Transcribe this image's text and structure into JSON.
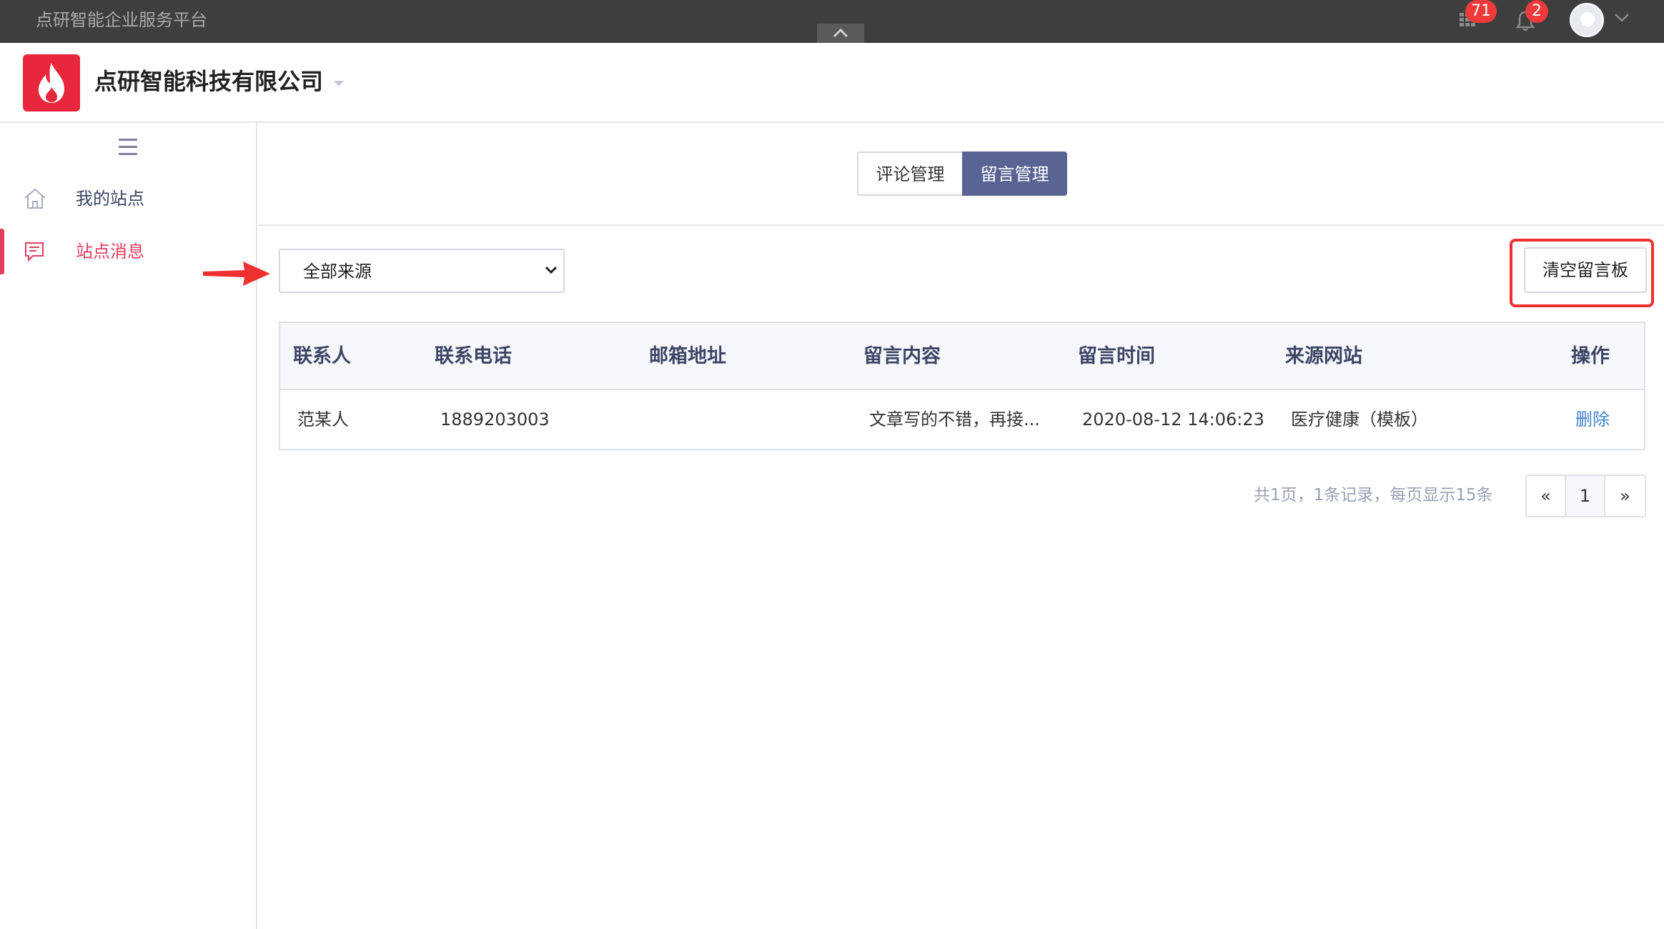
{
  "topbar": {
    "title": "点研智能企业服务平台",
    "apps_badge": "71",
    "notify_badge": "2",
    "icons": [
      "apps-grid-icon",
      "bell-icon",
      "avatar",
      "chevron-down-icon",
      "chevron-up-icon"
    ]
  },
  "header": {
    "company": "点研智能科技有限公司",
    "logo_icon": "flame-icon",
    "brand_color": "#e8263c"
  },
  "sidebar": {
    "items": [
      {
        "label": "我的站点",
        "icon": "home-icon",
        "active": false
      },
      {
        "label": "站点消息",
        "icon": "message-icon",
        "active": true
      }
    ],
    "active_color": "#e23d5e"
  },
  "tabs": [
    {
      "label": "评论管理",
      "selected": false
    },
    {
      "label": "留言管理",
      "selected": true
    }
  ],
  "filter": {
    "source_value": "全部来源"
  },
  "toolbar": {
    "clear_label": "清空留言板"
  },
  "table": {
    "columns": [
      "联系人",
      "联系电话",
      "邮箱地址",
      "留言内容",
      "留言时间",
      "来源网站",
      "操作"
    ],
    "rows": [
      {
        "contact": "范某人",
        "phone": "1889203003",
        "email": "",
        "content": "文章写的不错，再接...",
        "time": "2020-08-12 14:06:23",
        "source": "医疗健康（模板）",
        "action": "删除"
      }
    ]
  },
  "pagination": {
    "info": "共1页，1条记录，每页显示15条",
    "prev": "«",
    "current": "1",
    "next": "»"
  },
  "colors": {
    "tab_active": "#5a6494",
    "link": "#3f83c9",
    "annotation_red": "#ee3030"
  }
}
